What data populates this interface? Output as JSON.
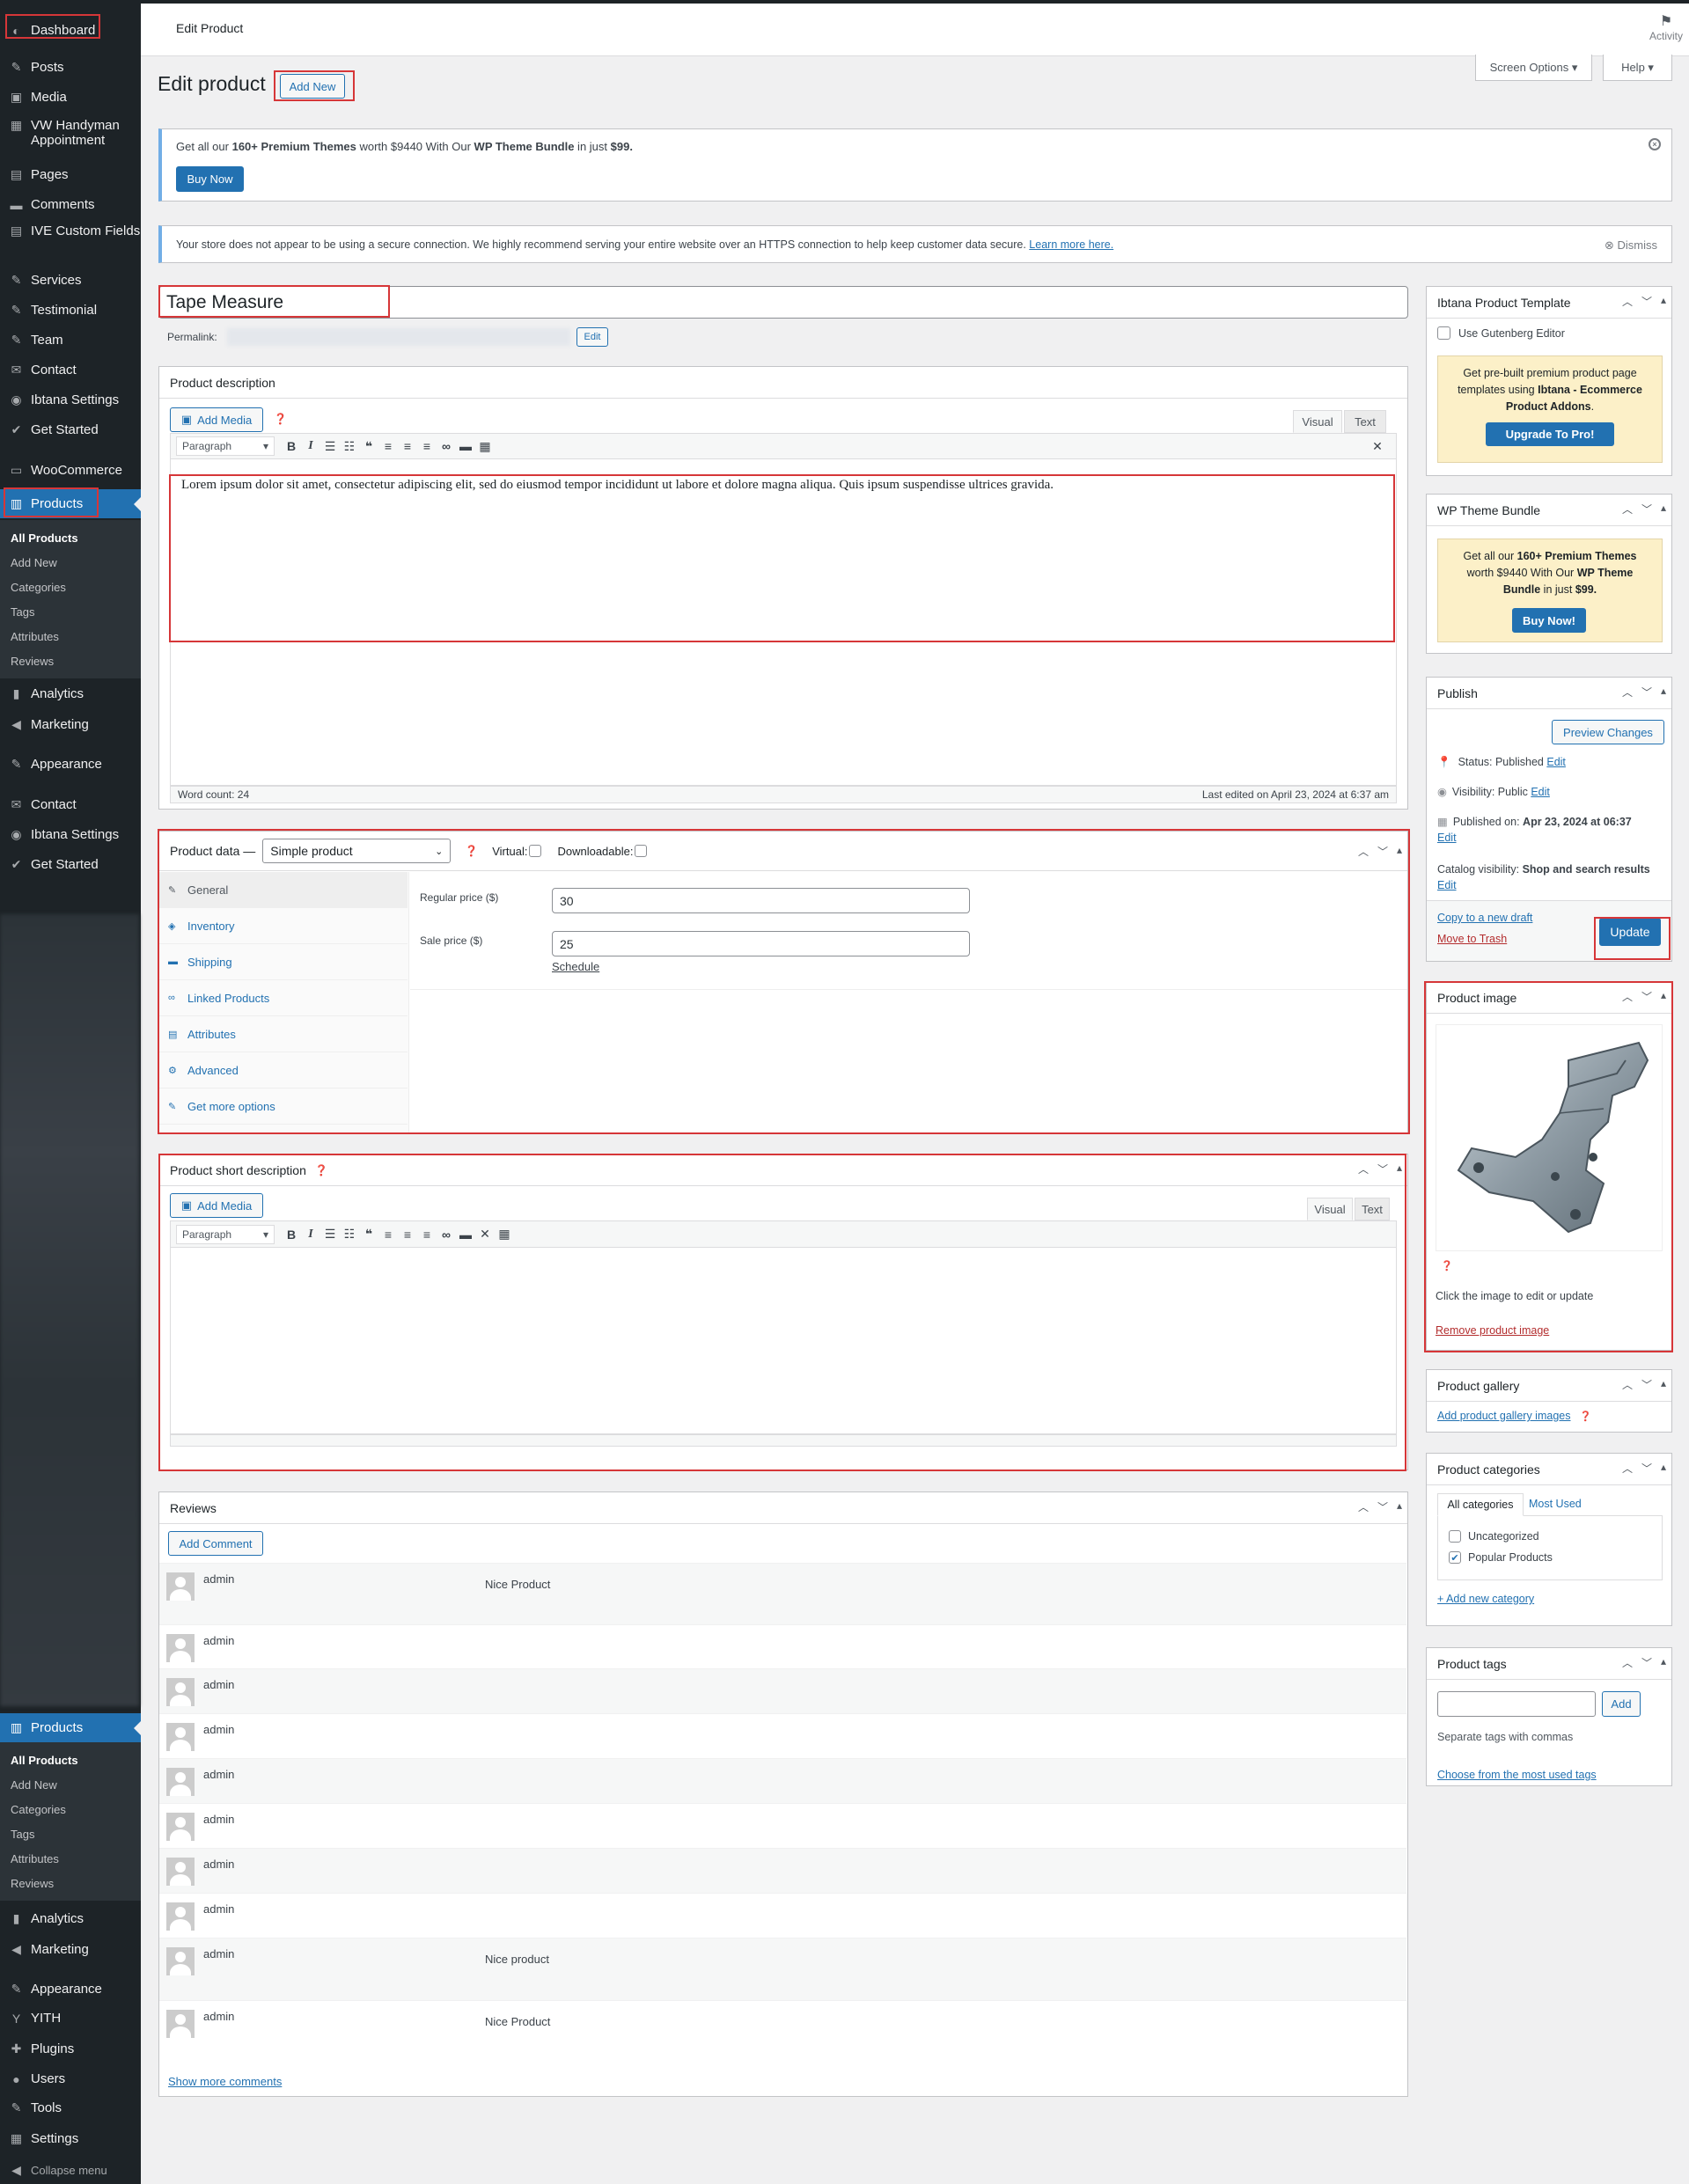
{
  "sidebar": {
    "items_top": [
      {
        "label": "Dashboard",
        "icon": "dashboard-icon",
        "glyph": "◐"
      },
      {
        "label": "Posts",
        "icon": "pin-icon",
        "glyph": "✎"
      },
      {
        "label": "Media",
        "icon": "media-icon",
        "glyph": "▣"
      },
      {
        "label": "VW Handyman Appointment",
        "icon": "calendar-icon",
        "glyph": "▦"
      },
      {
        "label": "Pages",
        "icon": "pages-icon",
        "glyph": "▤"
      },
      {
        "label": "Comments",
        "icon": "comments-icon",
        "glyph": "▬"
      },
      {
        "label": "IVE Custom Fields",
        "icon": "fields-icon",
        "glyph": "▤"
      },
      {
        "label": "Services",
        "icon": "pin-icon",
        "glyph": "✎"
      },
      {
        "label": "Testimonial",
        "icon": "pin-icon",
        "glyph": "✎"
      },
      {
        "label": "Team",
        "icon": "pin-icon",
        "glyph": "✎"
      },
      {
        "label": "Contact",
        "icon": "mail-icon",
        "glyph": "✉"
      },
      {
        "label": "Ibtana Settings",
        "icon": "ibtana-icon",
        "glyph": "◉"
      },
      {
        "label": "Get Started",
        "icon": "check-icon",
        "glyph": "✔"
      },
      {
        "label": "WooCommerce",
        "icon": "woo-icon",
        "glyph": "▭"
      },
      {
        "label": "Products",
        "icon": "products-icon",
        "glyph": "▥"
      }
    ],
    "products_sub_top": [
      "All Products",
      "Add New",
      "Categories",
      "Tags",
      "Attributes",
      "Reviews"
    ],
    "items_mid": [
      {
        "label": "Analytics",
        "icon": "analytics-icon",
        "glyph": "▮"
      },
      {
        "label": "Marketing",
        "icon": "megaphone-icon",
        "glyph": "◀"
      },
      {
        "label": "Appearance",
        "icon": "brush-icon",
        "glyph": "✎"
      },
      {
        "label": "Contact",
        "icon": "mail-icon",
        "glyph": "✉"
      },
      {
        "label": "Ibtana Settings",
        "icon": "ibtana-icon",
        "glyph": "◉"
      },
      {
        "label": "Get Started",
        "icon": "check-icon",
        "glyph": "✔"
      }
    ],
    "products_active": "Products",
    "products_sub_bottom": [
      "All Products",
      "Add New",
      "Categories",
      "Tags",
      "Attributes",
      "Reviews"
    ],
    "items_bottom": [
      {
        "label": "Analytics",
        "icon": "analytics-icon",
        "glyph": "▮"
      },
      {
        "label": "Marketing",
        "icon": "megaphone-icon",
        "glyph": "◀"
      },
      {
        "label": "Appearance",
        "icon": "brush-icon",
        "glyph": "✎"
      },
      {
        "label": "YITH",
        "icon": "yith-icon",
        "glyph": "Y"
      },
      {
        "label": "Plugins",
        "icon": "plugins-icon",
        "glyph": "✚"
      },
      {
        "label": "Users",
        "icon": "users-icon",
        "glyph": "●"
      },
      {
        "label": "Tools",
        "icon": "tools-icon",
        "glyph": "✎"
      },
      {
        "label": "Settings",
        "icon": "settings-icon",
        "glyph": "▦"
      },
      {
        "label": "Collapse menu",
        "icon": "collapse-icon",
        "glyph": "◀"
      }
    ]
  },
  "header": {
    "title": "Edit Product",
    "activity": "Activity",
    "screen_options": "Screen Options ▾",
    "help": "Help ▾"
  },
  "page": {
    "heading": "Edit product",
    "add_new": "Add New"
  },
  "notice_bundle": {
    "text_a": "Get all our ",
    "text_b": "160+ Premium Themes",
    "text_c": " worth $9440 With Our ",
    "text_d": "WP Theme Bundle",
    "text_e": " in just ",
    "text_f": "$99.",
    "button": "Buy Now"
  },
  "notice_https": {
    "text": "Your store does not appear to be using a secure connection. We highly recommend serving your entire website over an HTTPS connection to help keep customer data secure. ",
    "link": "Learn more here.",
    "dismiss": "Dismiss"
  },
  "product": {
    "title": "Tape Measure",
    "permalink_label": "Permalink:",
    "permalink_edit": "Edit"
  },
  "description": {
    "heading": "Product description",
    "add_media": "Add Media",
    "tab_visual": "Visual",
    "tab_text": "Text",
    "format": "Paragraph",
    "content": "Lorem ipsum dolor sit amet, consectetur adipiscing elit, sed do eiusmod tempor incididunt ut labore et dolore magna aliqua. Quis ipsum suspendisse ultrices gravida.",
    "word_count": "Word count: 24",
    "last_edited": "Last edited on April 23, 2024 at 6:37 am"
  },
  "product_data": {
    "heading": "Product data —",
    "type": "Simple product",
    "virtual": "Virtual:",
    "downloadable": "Downloadable:",
    "tabs": [
      "General",
      "Inventory",
      "Shipping",
      "Linked Products",
      "Attributes",
      "Advanced",
      "Get more options"
    ],
    "regular_label": "Regular price ($)",
    "regular_value": "30",
    "sale_label": "Sale price ($)",
    "sale_value": "25",
    "schedule": "Schedule"
  },
  "short_description": {
    "heading": "Product short description",
    "add_media": "Add Media",
    "tab_visual": "Visual",
    "tab_text": "Text",
    "format": "Paragraph"
  },
  "reviews": {
    "heading": "Reviews",
    "add_comment": "Add Comment",
    "rows": [
      {
        "author": "admin",
        "text": "Nice Product"
      },
      {
        "author": "admin",
        "text": ""
      },
      {
        "author": "admin",
        "text": ""
      },
      {
        "author": "admin",
        "text": ""
      },
      {
        "author": "admin",
        "text": ""
      },
      {
        "author": "admin",
        "text": ""
      },
      {
        "author": "admin",
        "text": ""
      },
      {
        "author": "admin",
        "text": ""
      },
      {
        "author": "admin",
        "text": "Nice product"
      },
      {
        "author": "admin",
        "text": "Nice Product"
      }
    ],
    "show_more": "Show more comments"
  },
  "ibtana_template": {
    "heading": "Ibtana Product Template",
    "checkbox": "Use Gutenberg Editor",
    "promo_a": "Get pre-built premium product page templates using ",
    "promo_b": "Ibtana - Ecommerce Product Addons",
    "promo_c": ".",
    "button": "Upgrade To Pro!"
  },
  "wp_bundle": {
    "heading": "WP Theme Bundle",
    "text_a": "Get all our ",
    "text_b": "160+ Premium Themes",
    "text_c": " worth $9440 With Our ",
    "text_d": "WP Theme Bundle",
    "text_e": " in just ",
    "text_f": "$99.",
    "button": "Buy Now!"
  },
  "publish": {
    "heading": "Publish",
    "preview": "Preview Changes",
    "status_label": "Status: ",
    "status_value": "Published",
    "visibility_label": "Visibility: ",
    "visibility_value": "Public",
    "published_label": "Published on: ",
    "published_value": "Apr 23, 2024 at 06:37",
    "catalog_label": "Catalog visibility: ",
    "catalog_value": "Shop and search results",
    "edit": "Edit",
    "copy_draft": "Copy to a new draft",
    "trash": "Move to Trash",
    "update": "Update"
  },
  "product_image": {
    "heading": "Product image",
    "hint": "Click the image to edit or update",
    "remove": "Remove product image"
  },
  "gallery": {
    "heading": "Product gallery",
    "add": "Add product gallery images"
  },
  "categories": {
    "heading": "Product categories",
    "tab_all": "All categories",
    "tab_most": "Most Used",
    "items": [
      {
        "label": "Uncategorized",
        "checked": false
      },
      {
        "label": "Popular Products",
        "checked": true
      }
    ],
    "add_new": "+ Add new category"
  },
  "tags": {
    "heading": "Product tags",
    "add": "Add",
    "hint": "Separate tags with commas",
    "choose": "Choose from the most used tags"
  },
  "colors": {
    "sidebar": "#1d2327",
    "accent": "#2271b1",
    "highlight": "#d63638",
    "promo": "#fcf0c8"
  }
}
